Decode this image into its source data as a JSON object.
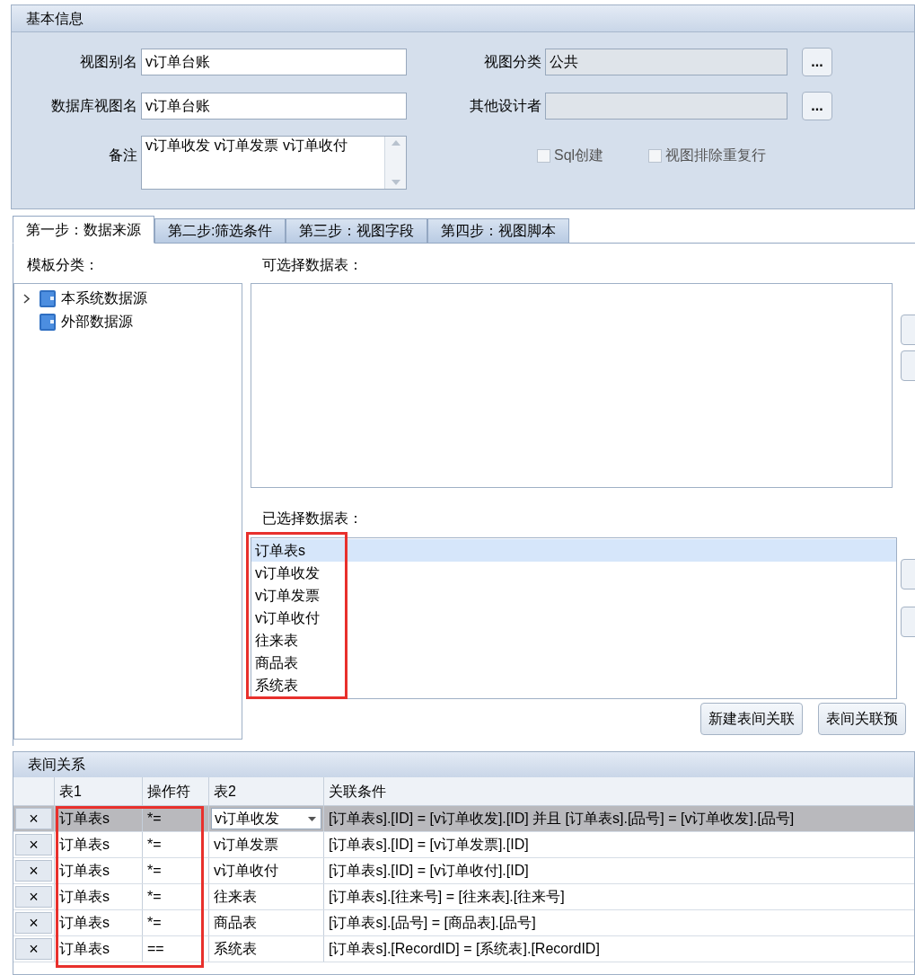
{
  "basic_info": {
    "title": "基本信息",
    "fields": [
      {
        "label": "视图别名",
        "value": "v订单台账",
        "disabled": false
      },
      {
        "label": "视图分类",
        "value": "公共",
        "disabled": true,
        "browse": "..."
      },
      {
        "label": "数据库视图名",
        "value": "v订单台账",
        "disabled": false
      },
      {
        "label": "其他设计者",
        "disabled": true,
        "browse": "..."
      }
    ],
    "remark": {
      "label": "备注",
      "value": "v订单收发 v订单发票 v订单收付"
    },
    "checkboxes": [
      {
        "label": "Sql创建",
        "checked": false
      },
      {
        "label": "视图排除重复行",
        "checked": false
      }
    ]
  },
  "tabs": [
    {
      "label": "第一步：数据来源",
      "selected": true
    },
    {
      "label": "第二步:筛选条件",
      "selected": false
    },
    {
      "label": "第三步：视图字段",
      "selected": false
    },
    {
      "label": "第四步：视图脚本",
      "selected": false
    }
  ],
  "template_category": {
    "label": "模板分类：",
    "items": [
      {
        "label": "本系统数据源",
        "expandable": true
      },
      {
        "label": "外部数据源",
        "expandable": false
      }
    ]
  },
  "available_tables": {
    "label": "可选择数据表："
  },
  "selected_tables": {
    "label": "已选择数据表：",
    "items": [
      {
        "label": "订单表s",
        "selected": true
      },
      {
        "label": "v订单收发",
        "selected": false
      },
      {
        "label": "v订单发票",
        "selected": false
      },
      {
        "label": "v订单收付",
        "selected": false
      },
      {
        "label": "往来表",
        "selected": false
      },
      {
        "label": "商品表",
        "selected": false
      },
      {
        "label": "系统表",
        "selected": false
      }
    ]
  },
  "buttons": [
    "新建表间关联",
    "表间关联预"
  ],
  "relations": {
    "title": "表间关系",
    "columns": [
      "表1",
      "操作符",
      "表2",
      "关联条件"
    ],
    "rows": [
      {
        "delete": "×",
        "table1": "订单表s",
        "operator": "*=",
        "table2": "v订单收发",
        "condition": "[订单表s].[ID] = [v订单收发].[ID] 并且 [订单表s].[品号] = [v订单收发].[品号]",
        "selected": true
      },
      {
        "delete": "×",
        "table1": "订单表s",
        "operator": "*=",
        "table2": "v订单发票",
        "condition": "[订单表s].[ID] = [v订单发票].[ID]",
        "selected": false
      },
      {
        "delete": "×",
        "table1": "订单表s",
        "operator": "*=",
        "table2": "v订单收付",
        "condition": "[订单表s].[ID] = [v订单收付].[ID]",
        "selected": false
      },
      {
        "delete": "×",
        "table1": "订单表s",
        "operator": "*=",
        "table2": "往来表",
        "condition": "[订单表s].[往来号] = [往来表].[往来号]",
        "selected": false
      },
      {
        "delete": "×",
        "table1": "订单表s",
        "operator": "*=",
        "table2": "商品表",
        "condition": "[订单表s].[品号] = [商品表].[品号]",
        "selected": false
      },
      {
        "delete": "×",
        "table1": "订单表s",
        "operator": "==",
        "table2": "系统表",
        "condition": "[订单表s].[RecordID] = [系统表].[RecordID]",
        "selected": false
      }
    ]
  }
}
